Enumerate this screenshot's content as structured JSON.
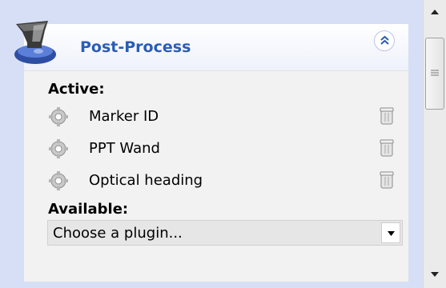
{
  "panel": {
    "title": "Post-Process",
    "icon": "post-process-device-icon",
    "collapse_icon": "double-chevron-up-icon"
  },
  "active": {
    "label": "Active:",
    "plugins": [
      {
        "name": "Marker ID",
        "icon": "gear-icon",
        "action_icon": "trash-can-icon"
      },
      {
        "name": "PPT Wand",
        "icon": "gear-icon",
        "action_icon": "trash-can-icon"
      },
      {
        "name": "Optical heading",
        "icon": "gear-icon",
        "action_icon": "trash-can-icon"
      }
    ]
  },
  "available": {
    "label": "Available:",
    "select_value": "Choose a plugin..."
  },
  "colors": {
    "title": "#2a5db5",
    "panel_bg": "#d6dff5",
    "body_bg": "#f2f2f2"
  }
}
